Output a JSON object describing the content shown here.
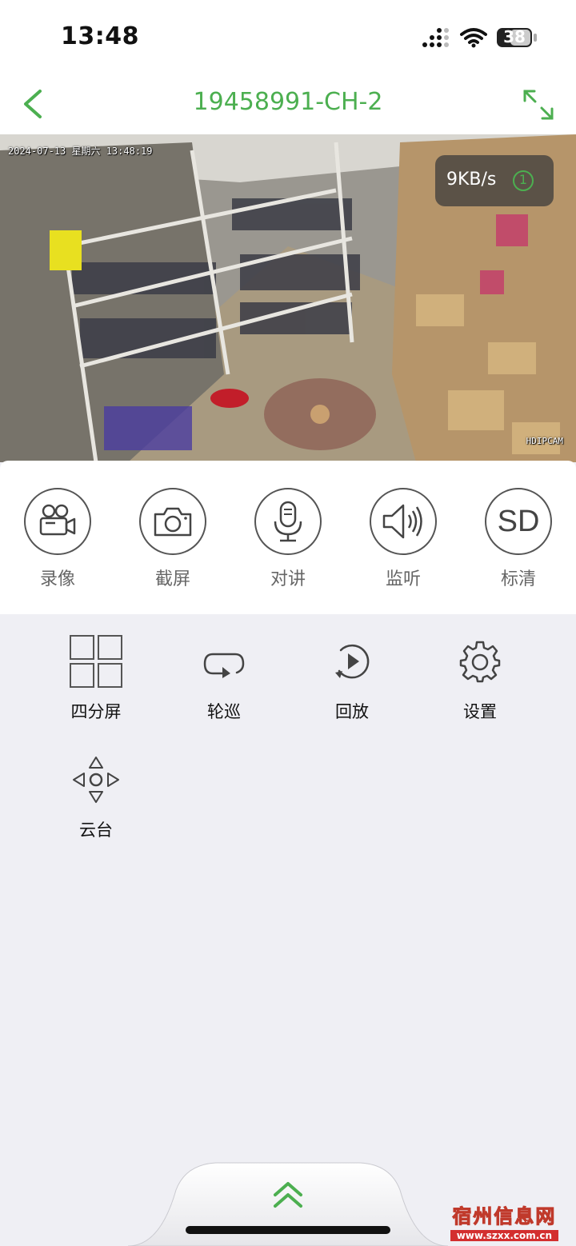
{
  "status_bar": {
    "time": "13:48",
    "battery": "38",
    "icons": [
      "signal-icon",
      "wifi-icon",
      "battery-icon"
    ]
  },
  "nav": {
    "title": "19458991-CH-2",
    "back_icon": "chevron-left-icon",
    "fullscreen_icon": "expand-icon",
    "accent_color": "#4caf50"
  },
  "video": {
    "timestamp": "2024-07-13 星期六 13:48:19",
    "brand": "HDIPCAM",
    "rate": "9KB/s",
    "rate_badge": "1"
  },
  "controls": [
    {
      "label": "录像",
      "icon": "video-camera-icon"
    },
    {
      "label": "截屏",
      "icon": "camera-icon"
    },
    {
      "label": "对讲",
      "icon": "microphone-icon"
    },
    {
      "label": "监听",
      "icon": "speaker-icon"
    },
    {
      "label": "标清",
      "icon": "sd-icon",
      "glyph": "SD"
    }
  ],
  "tools": [
    {
      "label": "四分屏",
      "icon": "quad-screen-icon"
    },
    {
      "label": "轮巡",
      "icon": "cycle-icon"
    },
    {
      "label": "回放",
      "icon": "playback-icon"
    },
    {
      "label": "设置",
      "icon": "gear-icon"
    },
    {
      "label": "云台",
      "icon": "ptz-icon"
    }
  ],
  "bottom": {
    "expand_icon": "double-chevron-up-icon"
  },
  "watermark": {
    "title": "宿州信息网",
    "url": "www.szxx.com.cn"
  }
}
